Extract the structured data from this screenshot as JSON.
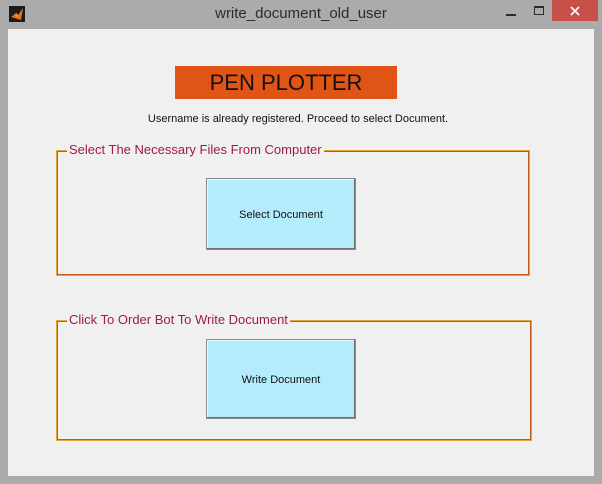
{
  "window": {
    "title": "write_document_old_user",
    "icon": "matlab-icon",
    "controls": {
      "minimize": "minimize-icon",
      "maximize": "maximize-icon",
      "close": "close-icon"
    }
  },
  "banner": {
    "text": "PEN PLOTTER",
    "background": "#e05515"
  },
  "status_text": "Username is already registered. Proceed to select Document.",
  "panels": [
    {
      "title": "Select The Necessary Files From Computer",
      "button_label": "Select Document"
    },
    {
      "title": "Click To Order Bot To Write Document",
      "button_label": "Write Document"
    }
  ],
  "colors": {
    "button_bg": "#b4ecfb",
    "panel_title": "#a11b3d",
    "panel_border": "#e4a33a",
    "close_button": "#c7504a"
  }
}
